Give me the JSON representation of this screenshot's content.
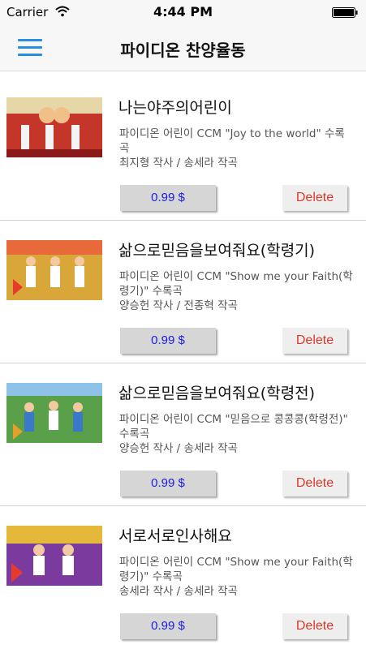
{
  "status_bar": {
    "carrier": "Carrier",
    "time": "4:44 PM"
  },
  "nav": {
    "title": "파이디온 찬양율동",
    "menu_icon": "menu-icon"
  },
  "items": [
    {
      "title": "나는야주의어린이",
      "desc": "파이디온 어린이 CCM \"Joy to the world\" 수록곡",
      "credit": "최지형 작사 / 송세라 작곡",
      "price": "0.99 $",
      "delete": "Delete",
      "thumb_color": "#c4352a"
    },
    {
      "title": "삶으로믿음을보여줘요(학령기)",
      "desc": "파이디온 어린이 CCM \"Show me your Faith(학령기)\" 수록곡",
      "credit": "양승헌 작사 / 전종혁 작곡",
      "price": "0.99 $",
      "delete": "Delete",
      "thumb_color": "#d9a63a"
    },
    {
      "title": "삶으로믿음을보여줘요(학령전)",
      "desc": "파이디온 어린이 CCM \"믿음으로 콩콩콩(학령전)\" 수록곡",
      "credit": "양승헌 작사 / 송세라 작곡",
      "price": "0.99 $",
      "delete": "Delete",
      "thumb_color": "#5aa04a"
    },
    {
      "title": "서로서로인사해요",
      "desc": "파이디온 어린이 CCM \"Show me your Faith(학령기)\" 수록곡",
      "credit": "송세라 작사 / 송세라 작곡",
      "price": "0.99 $",
      "delete": "Delete",
      "thumb_color": "#7b3a9e"
    }
  ],
  "colors": {
    "accent": "#2a8fe0",
    "price_text": "#1c1ce0",
    "delete_text": "#d93a2a"
  }
}
